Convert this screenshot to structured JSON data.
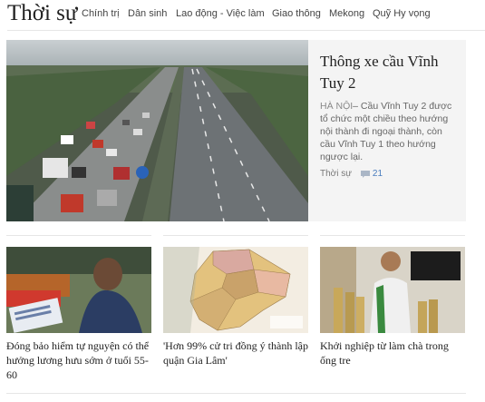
{
  "header": {
    "section_title": "Thời sự",
    "nav": [
      "Chính trị",
      "Dân sinh",
      "Lao động - Việc làm",
      "Giao thông",
      "Mekong",
      "Quỹ Hy vọng"
    ]
  },
  "featured": {
    "title": "Thông xe cầu Vĩnh Tuy 2",
    "location": "HÀ NỘI",
    "summary": "– Cầu Vĩnh Tuy 2 được tổ chức một chiều theo hướng nội thành đi ngoại thành, còn cầu Vĩnh Tuy 1 theo hướng ngược lại.",
    "category": "Thời sự",
    "comments": "21",
    "image_icon": "bridge-traffic-photo"
  },
  "cards": [
    {
      "title": "Đóng bảo hiểm tự nguyện có thể hưởng lương hưu sớm ở tuổi 55-60",
      "image_icon": "woman-with-papers-photo"
    },
    {
      "title": "'Hơn 99% cử tri đồng ý thành lập quận Gia Lâm'",
      "image_icon": "district-map-photo"
    },
    {
      "title": "Khởi nghiệp từ làm chà trong ống tre",
      "image_icon": "man-with-bamboo-tubes-photo"
    }
  ],
  "colors": {
    "accent_link": "#4a7dbe",
    "featured_bg": "#f4f4f4"
  }
}
